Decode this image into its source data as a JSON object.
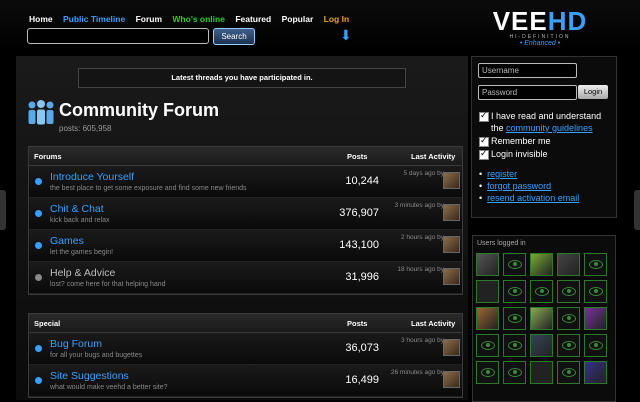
{
  "nav": {
    "home": "Home",
    "public_timeline": "Public Timeline",
    "forum": "Forum",
    "whos_online": "Who's online",
    "featured": "Featured",
    "popular": "Popular",
    "login": "Log In"
  },
  "search": {
    "button": "Search"
  },
  "logo": {
    "main_a": "VEE",
    "main_b": "HD",
    "sub": "HI-DEFINITION",
    "enhanced": "• Enhanced •"
  },
  "banner": "Latest threads you have participated in.",
  "forum": {
    "title": "Community Forum",
    "posts": "posts: 605,958"
  },
  "sections": [
    {
      "head": {
        "name": "Forums",
        "posts": "Posts",
        "activity": "Last Activity"
      },
      "rows": [
        {
          "name": "Introduce Yourself",
          "desc": "the best place to get some exposure and find some new friends",
          "count": "10,244",
          "activity": "5 days ago by"
        },
        {
          "name": "Chit & Chat",
          "desc": "kick back and relax",
          "count": "376,907",
          "activity": "3 minutes ago by"
        },
        {
          "name": "Games",
          "desc": "let the games begin!",
          "count": "143,100",
          "activity": "2 hours ago by"
        },
        {
          "name": "Help & Advice",
          "desc": "lost? come here for that helping hand",
          "count": "31,996",
          "activity": "18 hours ago by"
        }
      ]
    },
    {
      "head": {
        "name": "Special",
        "posts": "Posts",
        "activity": "Last Activity"
      },
      "rows": [
        {
          "name": "Bug Forum",
          "desc": "for all your bugs and bugettes",
          "count": "36,073",
          "activity": "3 hours ago by"
        },
        {
          "name": "Site Suggestions",
          "desc": "what would make veehd a better site?",
          "count": "16,499",
          "activity": "26 minutes ago by"
        }
      ]
    }
  ],
  "login_panel": {
    "username_placeholder": "Username",
    "password_placeholder": "Password",
    "login_button": "Login",
    "agree_prefix": "I have read and understand the",
    "agree_link": "community guidelines",
    "remember": "Remember me",
    "invisible": "Login invisible",
    "links": [
      "register",
      "forgot password",
      "resend activation email"
    ]
  },
  "users": {
    "title": "Users logged in"
  },
  "colors": {
    "accent": "#3aa0ff",
    "green": "#27d02a",
    "orange": "#f0a020"
  }
}
